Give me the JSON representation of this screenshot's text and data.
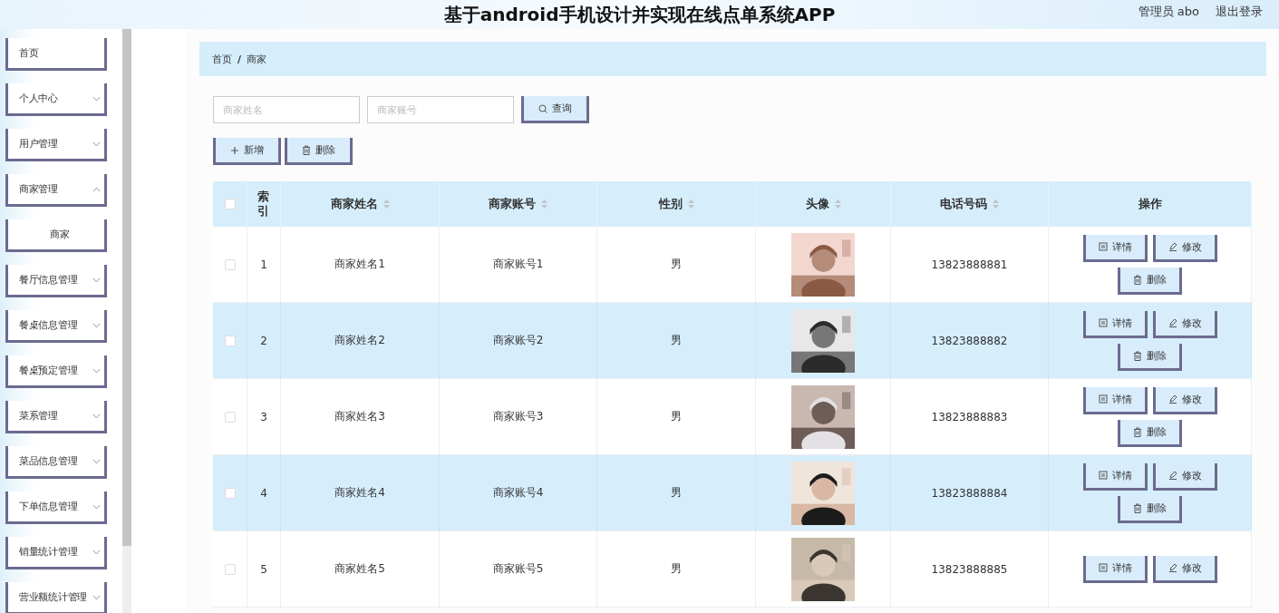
{
  "header": {
    "title": "基于android手机设计并实现在线点单系统APP",
    "user": "管理员 abo",
    "logout": "退出登录"
  },
  "sidebar": {
    "items": [
      {
        "kind": "link",
        "label": "首页"
      },
      {
        "kind": "group",
        "label": "个人中心",
        "expanded": false
      },
      {
        "kind": "group",
        "label": "用户管理",
        "expanded": false
      },
      {
        "kind": "group",
        "label": "商家管理",
        "expanded": true,
        "children": [
          {
            "label": "商家"
          }
        ]
      },
      {
        "kind": "group",
        "label": "餐厅信息管理",
        "expanded": false
      },
      {
        "kind": "group",
        "label": "餐桌信息管理",
        "expanded": false
      },
      {
        "kind": "group",
        "label": "餐桌预定管理",
        "expanded": false
      },
      {
        "kind": "group",
        "label": "菜系管理",
        "expanded": false
      },
      {
        "kind": "group",
        "label": "菜品信息管理",
        "expanded": false
      },
      {
        "kind": "group",
        "label": "下单信息管理",
        "expanded": false
      },
      {
        "kind": "group",
        "label": "销量统计管理",
        "expanded": false
      },
      {
        "kind": "group",
        "label": "营业额统计管理",
        "expanded": false
      }
    ]
  },
  "breadcrumb": {
    "items": [
      "首页",
      "商家"
    ],
    "separator": "/"
  },
  "search": {
    "fields": [
      {
        "placeholder": "商家姓名"
      },
      {
        "placeholder": "商家账号"
      }
    ],
    "button": "查询"
  },
  "actions": [
    {
      "kind": "add",
      "label": "新增"
    },
    {
      "kind": "delete",
      "label": "删除"
    }
  ],
  "table": {
    "select_all": {
      "checked": false
    },
    "columns": [
      {
        "label": "索引",
        "sortable": false
      },
      {
        "label": "商家姓名",
        "sortable": true
      },
      {
        "label": "商家账号",
        "sortable": true
      },
      {
        "label": "性别",
        "sortable": true
      },
      {
        "label": "头像",
        "sortable": true
      },
      {
        "label": "电话号码",
        "sortable": true
      },
      {
        "label": "操作",
        "sortable": false
      }
    ],
    "rows": [
      {
        "checked": false,
        "index": "1",
        "name": "商家姓名1",
        "account": "商家账号1",
        "gender": "男",
        "avatar": {
          "kind": "picture"
        },
        "phone": "13823888881",
        "actions": [
          {
            "kind": "detail",
            "label": "详情"
          },
          {
            "kind": "edit",
            "label": "修改"
          },
          {
            "kind": "delete",
            "label": "删除"
          }
        ]
      },
      {
        "checked": false,
        "index": "2",
        "name": "商家姓名2",
        "account": "商家账号2",
        "gender": "男",
        "avatar": {
          "kind": "picture"
        },
        "phone": "13823888882",
        "actions": [
          {
            "kind": "detail",
            "label": "详情"
          },
          {
            "kind": "edit",
            "label": "修改"
          },
          {
            "kind": "delete",
            "label": "删除"
          }
        ]
      },
      {
        "checked": false,
        "index": "3",
        "name": "商家姓名3",
        "account": "商家账号3",
        "gender": "男",
        "avatar": {
          "kind": "picture"
        },
        "phone": "13823888883",
        "actions": [
          {
            "kind": "detail",
            "label": "详情"
          },
          {
            "kind": "edit",
            "label": "修改"
          },
          {
            "kind": "delete",
            "label": "删除"
          }
        ]
      },
      {
        "checked": false,
        "index": "4",
        "name": "商家姓名4",
        "account": "商家账号4",
        "gender": "男",
        "avatar": {
          "kind": "picture"
        },
        "phone": "13823888884",
        "actions": [
          {
            "kind": "detail",
            "label": "详情"
          },
          {
            "kind": "edit",
            "label": "修改"
          },
          {
            "kind": "delete",
            "label": "删除"
          }
        ]
      },
      {
        "checked": false,
        "index": "5",
        "name": "商家姓名5",
        "account": "商家账号5",
        "gender": "男",
        "avatar": {
          "kind": "picture"
        },
        "phone": "13823888885",
        "actions": [
          {
            "kind": "detail",
            "label": "详情"
          },
          {
            "kind": "edit",
            "label": "修改"
          }
        ]
      }
    ]
  }
}
